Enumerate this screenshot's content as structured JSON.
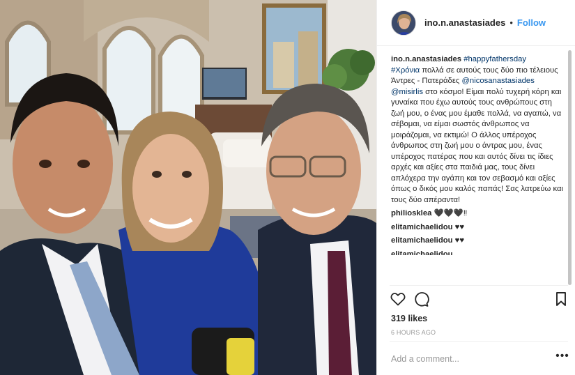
{
  "header": {
    "username": "ino.n.anastasiades",
    "separator": "•",
    "follow_label": "Follow"
  },
  "caption": {
    "username": "ino.n.anastasiades",
    "hashtag_1": "#happyfathersday",
    "hashtag_2": "#Χρόνια",
    "text_1": " πολλά σε αυτούς τους δύο πιο τέλειους Άντρες - Πατεράδες ",
    "mention_1": "@nicosanastasiades",
    "mention_2": "@misirlis",
    "text_2": " στο κόσμο! Είμαι πολύ τυχερή κόρη και γυναίκα που έχω αυτούς τους ανθρώπους στη ζωή μου, ο ένας μου έμαθε πολλά, να αγαπώ, να σέβομαι, να είμαι σωστός άνθρωπος να μοιράζομαι, να εκτιμώ! Ο άλλος υπέροχος άνθρωπος στη ζωή μου ο άντρας μου, ένας υπέροχος πατέρας που και αυτός δίνει τις ίδιες αρχές και αξίες στα παιδιά μας, τους δίνει απλόχερα την αγάπη και τον σεβασμό και αξίες όπως ο δικός μου καλός παπάς! Σας λατρεύω και τους δύο απέραντα!"
  },
  "comments": [
    {
      "username": "philiosklea",
      "text": " 🖤🖤🖤‼"
    },
    {
      "username": "elitamichaelidou",
      "text": " ♥♥"
    },
    {
      "username": "elitamichaelidou",
      "text": " ♥♥"
    },
    {
      "username": "elitamichaelidou",
      "text": ""
    }
  ],
  "actions": {
    "like_icon": "heart-outline-icon",
    "comment_icon": "comment-bubble-icon",
    "save_icon": "bookmark-outline-icon"
  },
  "likes": "319 likes",
  "timestamp": "6 HOURS AGO",
  "add_comment": {
    "placeholder": "Add a comment..."
  },
  "more_label": "•••",
  "colors": {
    "link": "#003569",
    "follow": "#3897f0",
    "muted": "#999999",
    "border": "#efefef",
    "text": "#262626"
  }
}
